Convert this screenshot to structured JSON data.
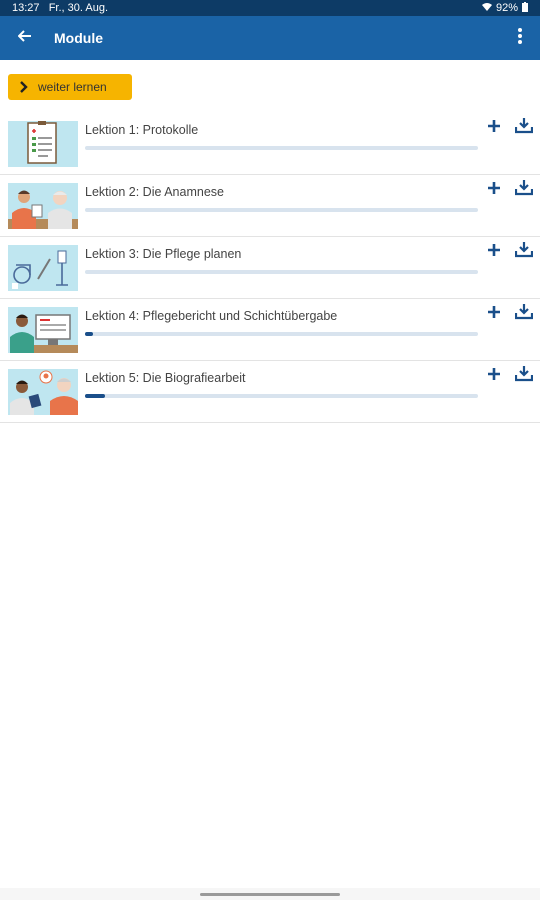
{
  "status": {
    "time": "13:27",
    "date": "Fr., 30. Aug.",
    "battery": "92%"
  },
  "app_bar": {
    "title": "Module"
  },
  "continue_button": {
    "label": "weiter lernen"
  },
  "colors": {
    "app_bar": "#1a63a6",
    "status_bar": "#0d3b66",
    "accent": "#f6b400",
    "progress_fill": "#1a4f8a"
  },
  "lessons": [
    {
      "label": "Lektion 1: Protokolle",
      "progress": 0.0
    },
    {
      "label": "Lektion 2: Die Anamnese",
      "progress": 0.0
    },
    {
      "label": "Lektion 3: Die Pflege planen",
      "progress": 0.0
    },
    {
      "label": "Lektion 4: Pflegebericht und Schichtübergabe",
      "progress": 0.02
    },
    {
      "label": "Lektion 5: Die Biografiearbeit",
      "progress": 0.05
    }
  ]
}
